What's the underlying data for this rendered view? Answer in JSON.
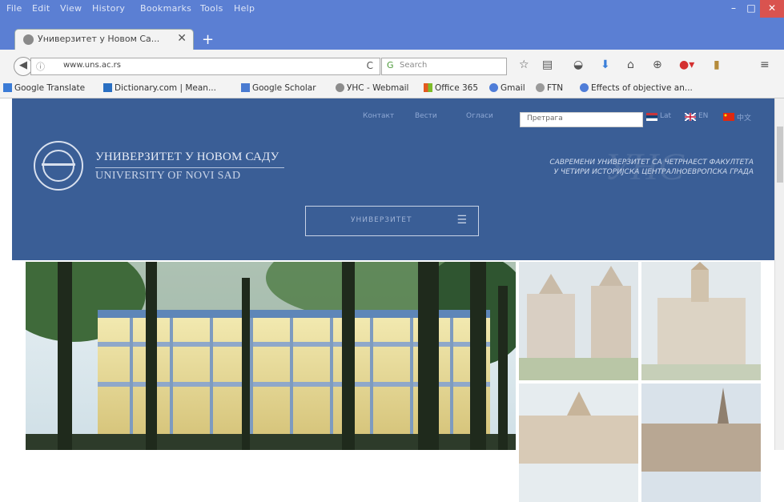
{
  "menu": [
    "File",
    "Edit",
    "View",
    "History",
    "Bookmarks",
    "Tools",
    "Help"
  ],
  "window_controls": {
    "minimize": "–",
    "restore": "□",
    "close": "✕"
  },
  "tab": {
    "title": "Универзитет у Новом Са...",
    "close": "✕",
    "new": "+"
  },
  "nav": {
    "url": "www.uns.ac.rs",
    "search_placeholder": "Search",
    "reload": "C"
  },
  "bookmarks": [
    {
      "label": "Google Translate",
      "icon": "google-translate-icon",
      "color": "#3b7bd6"
    },
    {
      "label": "Dictionary.com | Mean...",
      "icon": "dictionary-icon",
      "color": "#2a6fc2"
    },
    {
      "label": "Google Scholar",
      "icon": "google-scholar-icon",
      "color": "#4a7bd1"
    },
    {
      "label": "УНС - Webmail",
      "icon": "webmail-icon",
      "color": "#8c8c8c"
    },
    {
      "label": "Office 365",
      "icon": "office365-icon",
      "color": "#e45a1f"
    },
    {
      "label": "Gmail",
      "icon": "google-icon",
      "color": "#4f7dd8"
    },
    {
      "label": "FTN",
      "icon": "ftn-icon",
      "color": "#9a9a9a"
    },
    {
      "label": "Effects of objective an...",
      "icon": "google-icon",
      "color": "#4f7dd8"
    }
  ],
  "site": {
    "top_links": [
      "Контакт",
      "Вести",
      "Огласи"
    ],
    "search_placeholder": "Претрага",
    "languages": [
      "Lat",
      "EN",
      "中文"
    ],
    "university_cyrillic": "УНИВЕРЗИТЕТ У НОВОМ САДУ",
    "university_latin": "UNIVERSITY OF NOVI SAD",
    "tagline_line1": "САВРЕМЕНИ УНИВЕРЗИТЕТ СА ЧЕТРНАЕСТ ФАКУЛТЕТА",
    "tagline_line2": "У ЧЕТИРИ ИСТОРИЈСКА ЦЕНТРАЛНОЕВРОПСКА ГРАДА",
    "watermark": "УНС",
    "menu_button": "УНИВЕРЗИТЕТ",
    "menu_icon": "☰"
  },
  "colors": {
    "header_bg": "#3a5e96",
    "chrome": "#5b7fd3"
  }
}
